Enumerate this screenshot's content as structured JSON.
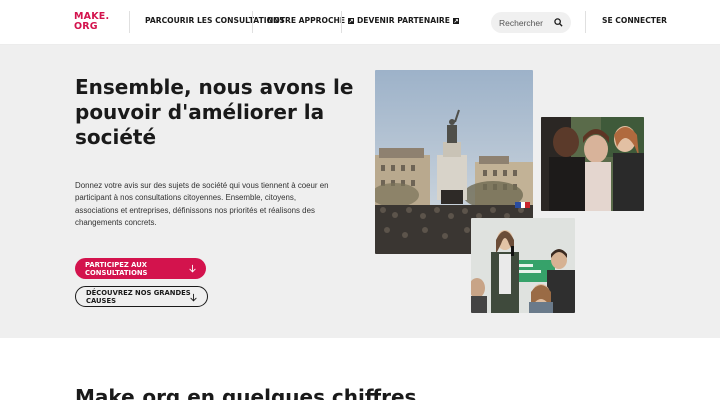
{
  "header": {
    "logo_line1": "MAKE.",
    "logo_line2": "ORG",
    "nav": [
      {
        "label": "PARCOURIR LES CONSULTATIONS"
      },
      {
        "label": "NOTRE APPROCHE"
      },
      {
        "label": "DEVENIR PARTENAIRE"
      }
    ],
    "search_placeholder": "Rechercher",
    "login_label": "SE CONNECTER"
  },
  "hero": {
    "title": "Ensemble, nous avons le pouvoir d'améliorer la société",
    "description": "Donnez votre avis sur des sujets de société qui vous tiennent à coeur en participant à nos consultations citoyennes. Ensemble, citoyens, associations et entreprises, définissons nos priorités et réalisons des changements concrets.",
    "primary_button": "PARTICIPEZ AUX CONSULTATIONS",
    "secondary_button": "DÉCOUVREZ NOS GRANDES CAUSES"
  },
  "stats_section": {
    "title": "Make.org en quelques chiffres"
  },
  "colors": {
    "brand": "#d3134d",
    "hero_bg": "#efefef"
  },
  "icons": {
    "external_link": "external-link-icon",
    "search": "search-icon",
    "arrow_down": "arrow-down-icon"
  }
}
